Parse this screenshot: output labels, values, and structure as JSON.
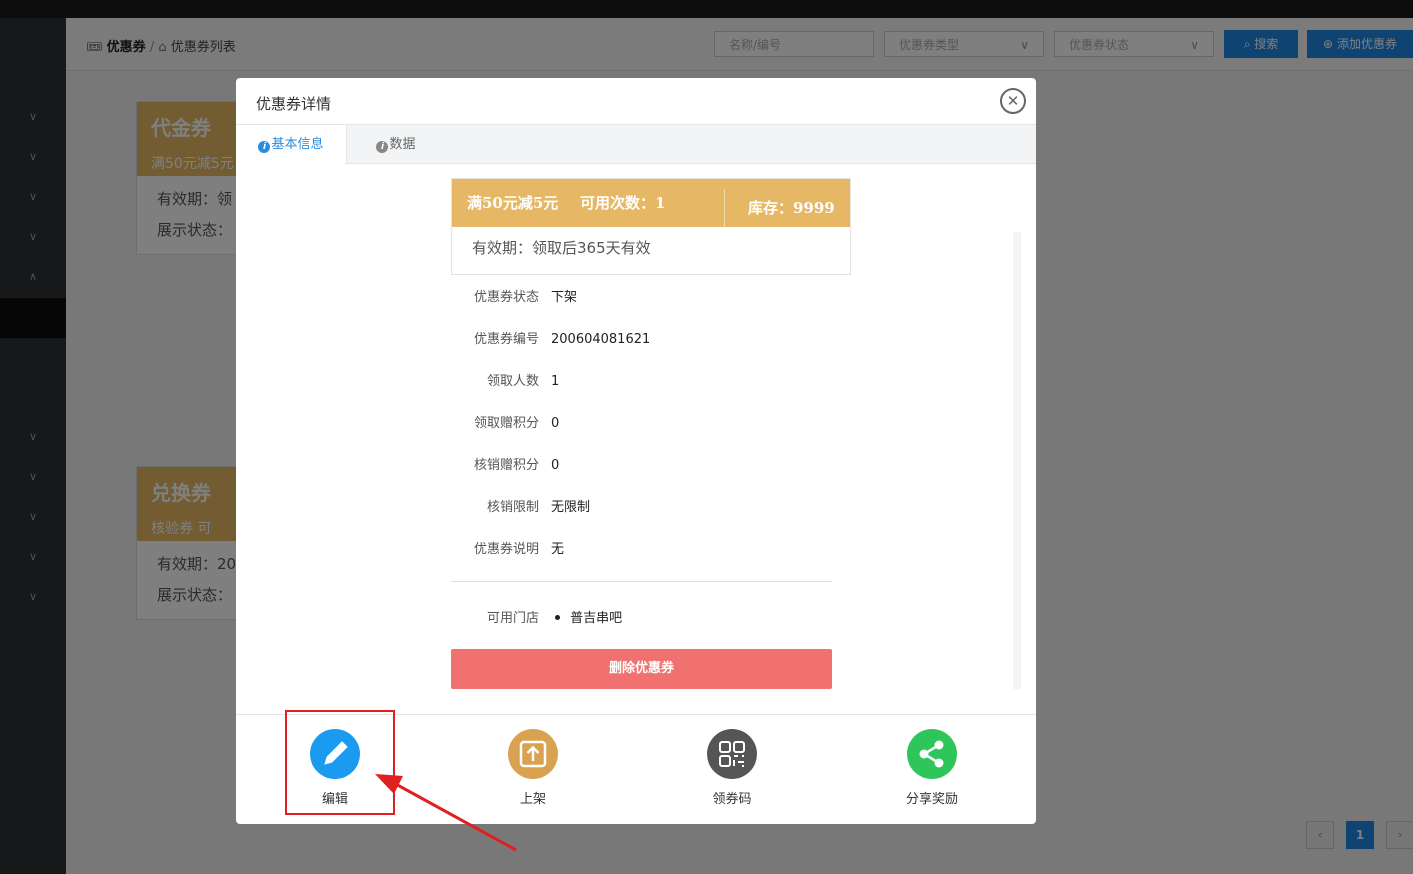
{
  "header": {
    "breadcrumb": {
      "root": "优惠券",
      "separator": "/",
      "current": "优惠券列表"
    },
    "search_placeholder": "名称/编号",
    "type_select": "优惠券类型",
    "status_select": "优惠券状态",
    "search_button": "搜索",
    "add_button": "添加优惠券"
  },
  "background_cards": [
    {
      "type": "代金券",
      "subtitle": "满50元减5元",
      "valid": "有效期：领",
      "status": "展示状态："
    },
    {
      "type": "兑换券",
      "subtitle": "核验券   可",
      "valid": "有效期：20",
      "status": "展示状态："
    }
  ],
  "pagination": {
    "prev": "‹",
    "current": "1",
    "next": "›"
  },
  "modal": {
    "title": "优惠券详情",
    "tabs": [
      {
        "label": "基本信息"
      },
      {
        "label": "数据"
      }
    ],
    "coupon": {
      "discount": "满50元减5元",
      "usage": "可用次数：1",
      "stock": "库存：9999",
      "validity": "有效期：领取后365天有效"
    },
    "details": [
      {
        "label": "优惠券状态",
        "value": "下架"
      },
      {
        "label": "优惠券编号",
        "value": "200604081621"
      },
      {
        "label": "领取人数",
        "value": "1"
      },
      {
        "label": "领取赠积分",
        "value": "0"
      },
      {
        "label": "核销赠积分",
        "value": "0"
      },
      {
        "label": "核销限制",
        "value": "无限制"
      },
      {
        "label": "优惠券说明",
        "value": "无"
      }
    ],
    "stores_label": "可用门店",
    "stores": [
      "普吉串吧"
    ],
    "delete_button": "删除优惠券",
    "actions": [
      {
        "label": "编辑",
        "icon": "pencil-icon",
        "color": "#1a9bf0"
      },
      {
        "label": "上架",
        "icon": "upload-icon",
        "color": "#d9a250"
      },
      {
        "label": "领券码",
        "icon": "qrcode-icon",
        "color": "#555555"
      },
      {
        "label": "分享奖励",
        "icon": "share-icon",
        "color": "#2ec55a"
      }
    ]
  },
  "colors": {
    "accent": "#1e88e5",
    "coupon_gold": "#e6b865",
    "danger": "#f07170",
    "annotation_red": "#e02020"
  }
}
